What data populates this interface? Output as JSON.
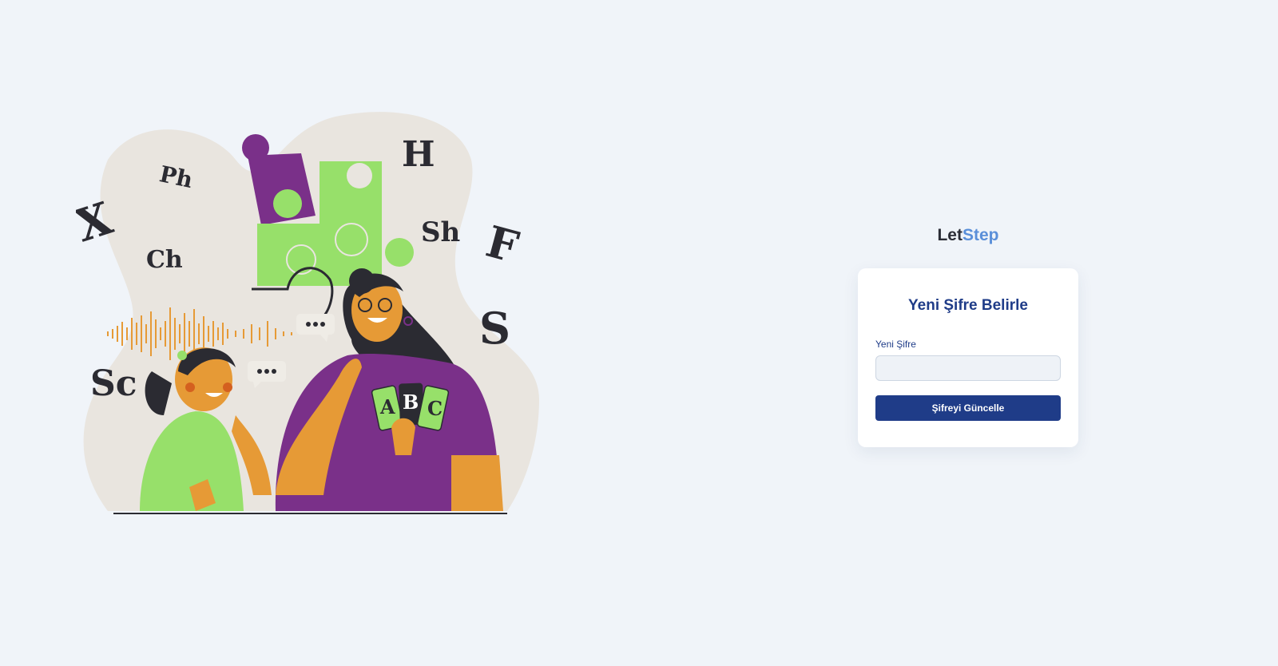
{
  "illustration": {
    "letters": [
      "X",
      "Ph",
      "Ch",
      "H",
      "Sh",
      "F",
      "S",
      "Sc"
    ],
    "cards": [
      "A",
      "B",
      "C"
    ],
    "colors": {
      "purple": "#7a3089",
      "green": "#97e06a",
      "orange": "#e69a36",
      "blob": "#e9e5df",
      "ink": "#2b2b32"
    }
  },
  "brand": {
    "part1": "Let",
    "part2": "Step"
  },
  "form": {
    "title": "Yeni Şifre Belirle",
    "password_label": "Yeni Şifre",
    "password_value": "",
    "submit_label": "Şifreyi Güncelle"
  },
  "colors": {
    "primary": "#1f3c88",
    "brand_accent": "#5a8fd9",
    "background": "#f0f4f9"
  }
}
